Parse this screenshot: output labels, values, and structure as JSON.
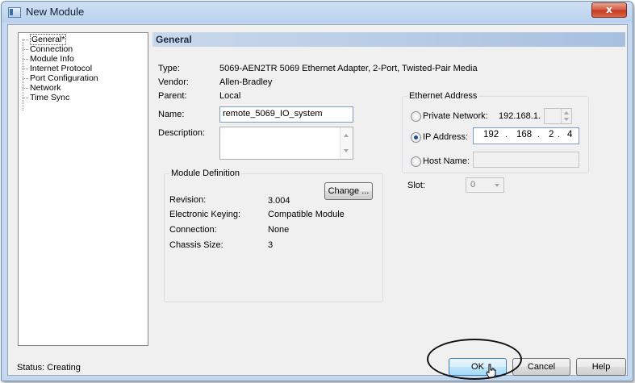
{
  "window": {
    "title": "New Module",
    "close_label": "x"
  },
  "tree": {
    "items": [
      {
        "label": "General*"
      },
      {
        "label": "Connection"
      },
      {
        "label": "Module Info"
      },
      {
        "label": "Internet Protocol"
      },
      {
        "label": "Port Configuration"
      },
      {
        "label": "Network"
      },
      {
        "label": "Time Sync"
      }
    ]
  },
  "panel": {
    "header": "General"
  },
  "info": {
    "type_label": "Type:",
    "type_value": "5069-AEN2TR 5069 Ethernet Adapter, 2-Port, Twisted-Pair Media",
    "vendor_label": "Vendor:",
    "vendor_value": "Allen-Bradley",
    "parent_label": "Parent:",
    "parent_value": "Local",
    "name_label": "Name:",
    "name_value": "remote_5069_IO_system",
    "description_label": "Description:",
    "description_value": ""
  },
  "module_definition": {
    "title": "Module Definition",
    "change_button": "Change ...",
    "rows": [
      {
        "label": "Revision:",
        "value": "3.004"
      },
      {
        "label": "Electronic Keying:",
        "value": "Compatible Module"
      },
      {
        "label": "Connection:",
        "value": "None"
      },
      {
        "label": "Chassis Size:",
        "value": "3"
      }
    ]
  },
  "ethernet": {
    "title": "Ethernet Address",
    "private_network_label": "Private Network:",
    "private_network_prefix": "192.168.1.",
    "ip_address_label": "IP Address:",
    "ip_octets": [
      "192",
      "168",
      "2",
      "4"
    ],
    "host_name_label": "Host Name:",
    "selected": "ip_address"
  },
  "slot": {
    "label": "Slot:",
    "value": "0"
  },
  "status": {
    "text": "Status:  Creating"
  },
  "buttons": {
    "ok": "OK",
    "cancel": "Cancel",
    "help": "Help"
  }
}
